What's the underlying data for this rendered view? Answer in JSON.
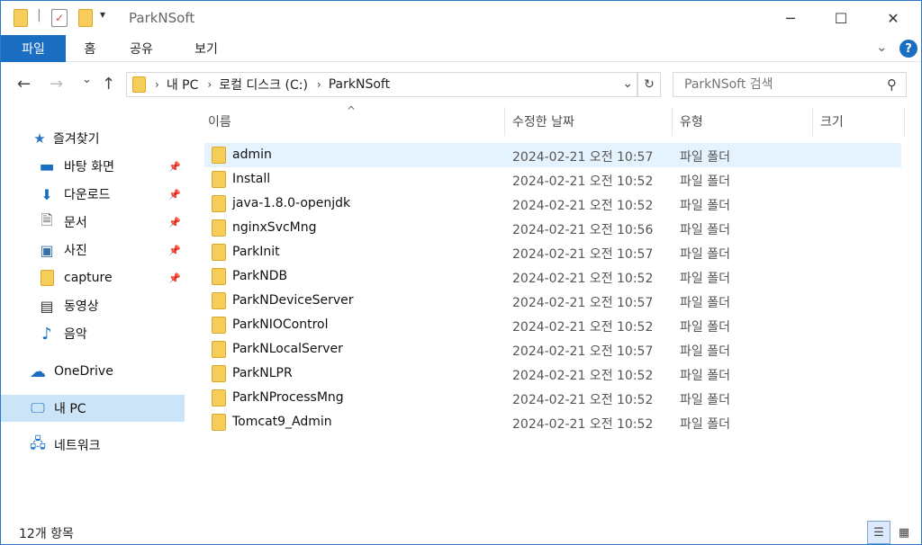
{
  "window": {
    "title": "ParkNSoft",
    "minimize_glyph": "─",
    "maximize_glyph": "☐",
    "close_glyph": "✕",
    "qa_separator": "|",
    "qa_dropdown_glyph": "▾"
  },
  "ribbon": {
    "tabs": [
      {
        "label": "파일",
        "active": true
      },
      {
        "label": "홈",
        "active": false
      },
      {
        "label": "공유",
        "active": false
      },
      {
        "label": "보기",
        "active": false
      }
    ],
    "expand_glyph": "⌄",
    "help_label": "?"
  },
  "nav": {
    "back_glyph": "←",
    "forward_glyph": "→",
    "recent_glyph": "⌄",
    "up_glyph": "↑",
    "breadcrumb": [
      "내 PC",
      "로컬 디스크 (C:)",
      "ParkNSoft"
    ],
    "breadcrumb_sep": "›",
    "dropdown_glyph": "⌄",
    "refresh_glyph": "↻",
    "search_placeholder": "ParkNSoft 검색",
    "search_glyph": "⚲"
  },
  "sidebar": {
    "pin_glyph": "📌",
    "quick_access": {
      "label": "즐겨찾기",
      "icon": "star-icon",
      "glyph": "★"
    },
    "items": [
      {
        "label": "바탕 화면",
        "icon": "desktop-icon",
        "glyph": "▬",
        "pinned": true
      },
      {
        "label": "다운로드",
        "icon": "download-icon",
        "glyph": "⬇",
        "pinned": true
      },
      {
        "label": "문서",
        "icon": "document-icon",
        "glyph": "🗎",
        "pinned": true
      },
      {
        "label": "사진",
        "icon": "pictures-icon",
        "glyph": "▣",
        "pinned": true
      },
      {
        "label": "capture",
        "icon": "folder-icon",
        "glyph": "",
        "pinned": true
      },
      {
        "label": "동영상",
        "icon": "videos-icon",
        "glyph": "▤",
        "pinned": false
      },
      {
        "label": "음악",
        "icon": "music-icon",
        "glyph": "♪",
        "pinned": false
      }
    ],
    "onedrive": {
      "label": "OneDrive",
      "icon": "cloud-icon",
      "glyph": "☁"
    },
    "this_pc": {
      "label": "내 PC",
      "icon": "computer-icon",
      "glyph": "🖵"
    },
    "network": {
      "label": "네트워크",
      "icon": "network-icon",
      "glyph": "🖧"
    }
  },
  "columns": [
    "이름",
    "수정한 날짜",
    "유형",
    "크기"
  ],
  "sort_glyph": "^",
  "files": [
    {
      "name": "admin",
      "modified": "2024-02-21 오전 10:57",
      "type": "파일 폴더"
    },
    {
      "name": "Install",
      "modified": "2024-02-21 오전 10:52",
      "type": "파일 폴더"
    },
    {
      "name": "java-1.8.0-openjdk",
      "modified": "2024-02-21 오전 10:52",
      "type": "파일 폴더"
    },
    {
      "name": "nginxSvcMng",
      "modified": "2024-02-21 오전 10:56",
      "type": "파일 폴더"
    },
    {
      "name": "ParkInit",
      "modified": "2024-02-21 오전 10:57",
      "type": "파일 폴더"
    },
    {
      "name": "ParkNDB",
      "modified": "2024-02-21 오전 10:52",
      "type": "파일 폴더"
    },
    {
      "name": "ParkNDeviceServer",
      "modified": "2024-02-21 오전 10:57",
      "type": "파일 폴더"
    },
    {
      "name": "ParkNIOControl",
      "modified": "2024-02-21 오전 10:52",
      "type": "파일 폴더"
    },
    {
      "name": "ParkNLocalServer",
      "modified": "2024-02-21 오전 10:57",
      "type": "파일 폴더"
    },
    {
      "name": "ParkNLPR",
      "modified": "2024-02-21 오전 10:52",
      "type": "파일 폴더"
    },
    {
      "name": "ParkNProcessMng",
      "modified": "2024-02-21 오전 10:52",
      "type": "파일 폴더"
    },
    {
      "name": "Tomcat9_Admin",
      "modified": "2024-02-21 오전 10:52",
      "type": "파일 폴더"
    }
  ],
  "status": {
    "item_count": "12개 항목",
    "details_glyph": "☰",
    "tiles_glyph": "▦"
  },
  "colors": {
    "accent": "#1a6ec2",
    "selection": "#cce4f7",
    "row_hover": "#e5f3ff",
    "folder": "#f7cd5a"
  }
}
